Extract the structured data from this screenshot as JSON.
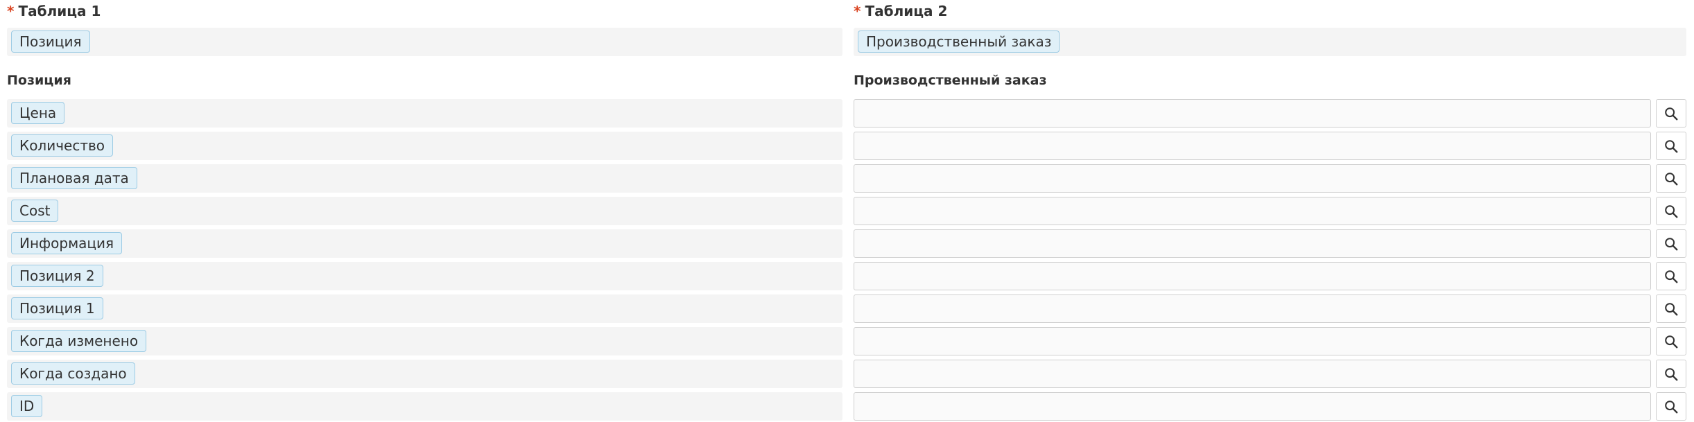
{
  "left": {
    "table_label": "Таблица 1",
    "table_tag": "Позиция",
    "fields_heading": "Позиция",
    "fields": [
      "Цена",
      "Количество",
      "Плановая дата",
      "Cost",
      "Информация",
      "Позиция 2",
      "Позиция 1",
      "Когда изменено",
      "Когда создано",
      "ID"
    ]
  },
  "right": {
    "table_label": "Таблица 2",
    "table_tag": "Производственный заказ",
    "fields_heading": "Производственный заказ",
    "inputs": [
      "",
      "",
      "",
      "",
      "",
      "",
      "",
      "",
      "",
      ""
    ]
  },
  "required_mark": "*",
  "icons": {
    "search": "search-icon"
  },
  "colors": {
    "required": "#d9411e",
    "tag_bg": "#e0f0f8",
    "tag_border": "#9ccbe4",
    "row_bg": "#f4f4f4"
  }
}
